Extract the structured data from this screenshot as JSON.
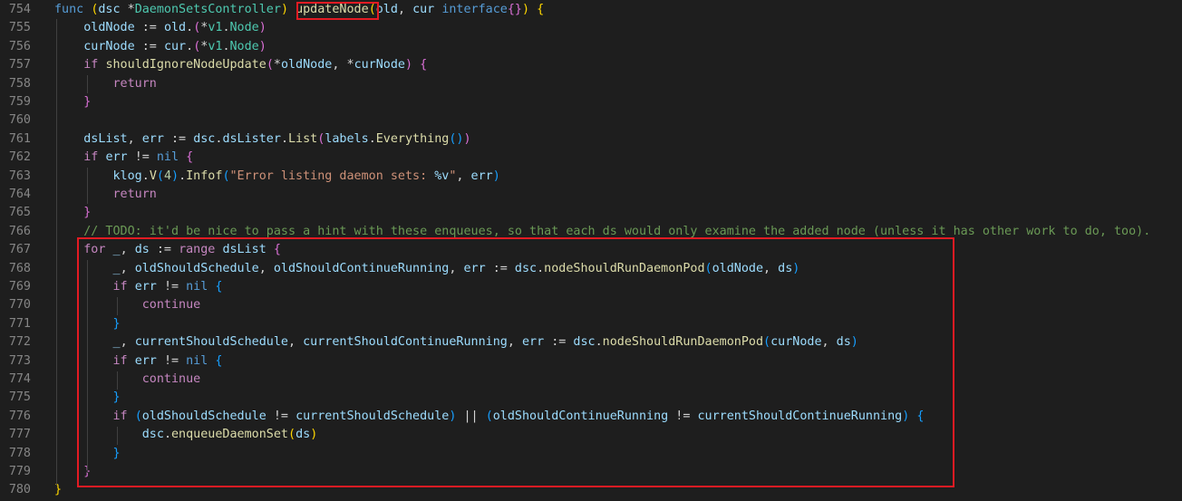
{
  "editor": {
    "theme_colors": {
      "background": "#1e1e1e",
      "line_number": "#858585",
      "keyword": "#569cd6",
      "control": "#c586c0",
      "function": "#dcdcaa",
      "variable": "#9cdcfe",
      "type": "#4ec9b0",
      "string": "#ce9178",
      "number": "#b5cea8",
      "comment": "#6a9955",
      "highlight_box": "#e31b23"
    },
    "lines": [
      {
        "n": "754",
        "t": [
          [
            "kw",
            "func "
          ],
          [
            "b1",
            "("
          ],
          [
            "var",
            "dsc "
          ],
          [
            "op",
            "*"
          ],
          [
            "typ",
            "DaemonSetsController"
          ],
          [
            "b1",
            ")"
          ],
          [
            "op",
            " "
          ],
          [
            "fn",
            "updateNode"
          ],
          [
            "b1",
            "("
          ],
          [
            "var",
            "old"
          ],
          [
            "op",
            ", "
          ],
          [
            "var",
            "cur "
          ],
          [
            "kw",
            "interface"
          ],
          [
            "b2",
            "{}"
          ],
          [
            "b1",
            ")"
          ],
          [
            "op",
            " "
          ],
          [
            "b1",
            "{"
          ]
        ]
      },
      {
        "n": "755",
        "t": [
          [
            "op",
            "    "
          ],
          [
            "var",
            "oldNode "
          ],
          [
            "op",
            ":= "
          ],
          [
            "var",
            "old"
          ],
          [
            "op",
            "."
          ],
          [
            "b2",
            "("
          ],
          [
            "op",
            "*"
          ],
          [
            "typ",
            "v1"
          ],
          [
            "op",
            "."
          ],
          [
            "typ",
            "Node"
          ],
          [
            "b2",
            ")"
          ]
        ]
      },
      {
        "n": "756",
        "t": [
          [
            "op",
            "    "
          ],
          [
            "var",
            "curNode "
          ],
          [
            "op",
            ":= "
          ],
          [
            "var",
            "cur"
          ],
          [
            "op",
            "."
          ],
          [
            "b2",
            "("
          ],
          [
            "op",
            "*"
          ],
          [
            "typ",
            "v1"
          ],
          [
            "op",
            "."
          ],
          [
            "typ",
            "Node"
          ],
          [
            "b2",
            ")"
          ]
        ]
      },
      {
        "n": "757",
        "t": [
          [
            "op",
            "    "
          ],
          [
            "ctl",
            "if "
          ],
          [
            "fn",
            "shouldIgnoreNodeUpdate"
          ],
          [
            "b2",
            "("
          ],
          [
            "op",
            "*"
          ],
          [
            "var",
            "oldNode"
          ],
          [
            "op",
            ", *"
          ],
          [
            "var",
            "curNode"
          ],
          [
            "b2",
            ")"
          ],
          [
            "op",
            " "
          ],
          [
            "b2",
            "{"
          ]
        ]
      },
      {
        "n": "758",
        "t": [
          [
            "op",
            "        "
          ],
          [
            "ctl",
            "return"
          ]
        ]
      },
      {
        "n": "759",
        "t": [
          [
            "op",
            "    "
          ],
          [
            "b2",
            "}"
          ]
        ]
      },
      {
        "n": "760",
        "t": []
      },
      {
        "n": "761",
        "t": [
          [
            "op",
            "    "
          ],
          [
            "var",
            "dsList"
          ],
          [
            "op",
            ", "
          ],
          [
            "var",
            "err "
          ],
          [
            "op",
            ":= "
          ],
          [
            "var",
            "dsc"
          ],
          [
            "op",
            "."
          ],
          [
            "var",
            "dsLister"
          ],
          [
            "op",
            "."
          ],
          [
            "fn",
            "List"
          ],
          [
            "b2",
            "("
          ],
          [
            "var",
            "labels"
          ],
          [
            "op",
            "."
          ],
          [
            "fn",
            "Everything"
          ],
          [
            "b3",
            "()"
          ],
          [
            "b2",
            ")"
          ]
        ]
      },
      {
        "n": "762",
        "t": [
          [
            "op",
            "    "
          ],
          [
            "ctl",
            "if "
          ],
          [
            "var",
            "err "
          ],
          [
            "op",
            "!= "
          ],
          [
            "kw",
            "nil "
          ],
          [
            "b2",
            "{"
          ]
        ]
      },
      {
        "n": "763",
        "t": [
          [
            "op",
            "        "
          ],
          [
            "var",
            "klog"
          ],
          [
            "op",
            "."
          ],
          [
            "fn",
            "V"
          ],
          [
            "b3",
            "("
          ],
          [
            "num",
            "4"
          ],
          [
            "b3",
            ")"
          ],
          [
            "op",
            "."
          ],
          [
            "fn",
            "Infof"
          ],
          [
            "b3",
            "("
          ],
          [
            "str",
            "\"Error listing daemon sets: "
          ],
          [
            "var",
            "%v"
          ],
          [
            "str",
            "\""
          ],
          [
            "op",
            ", "
          ],
          [
            "var",
            "err"
          ],
          [
            "b3",
            ")"
          ]
        ]
      },
      {
        "n": "764",
        "t": [
          [
            "op",
            "        "
          ],
          [
            "ctl",
            "return"
          ]
        ]
      },
      {
        "n": "765",
        "t": [
          [
            "op",
            "    "
          ],
          [
            "b2",
            "}"
          ]
        ]
      },
      {
        "n": "766",
        "t": [
          [
            "op",
            "    "
          ],
          [
            "cm",
            "// TODO: it'd be nice to pass a hint with these enqueues, so that each ds would only examine the added node (unless it has other work to do, too)."
          ]
        ]
      },
      {
        "n": "767",
        "t": [
          [
            "op",
            "    "
          ],
          [
            "ctl",
            "for "
          ],
          [
            "var",
            "_"
          ],
          [
            "op",
            ", "
          ],
          [
            "var",
            "ds "
          ],
          [
            "op",
            ":= "
          ],
          [
            "ctl",
            "range "
          ],
          [
            "var",
            "dsList "
          ],
          [
            "b2",
            "{"
          ]
        ]
      },
      {
        "n": "768",
        "t": [
          [
            "op",
            "        "
          ],
          [
            "var",
            "_"
          ],
          [
            "op",
            ", "
          ],
          [
            "var",
            "oldShouldSchedule"
          ],
          [
            "op",
            ", "
          ],
          [
            "var",
            "oldShouldContinueRunning"
          ],
          [
            "op",
            ", "
          ],
          [
            "var",
            "err "
          ],
          [
            "op",
            ":= "
          ],
          [
            "var",
            "dsc"
          ],
          [
            "op",
            "."
          ],
          [
            "fn",
            "nodeShouldRunDaemonPod"
          ],
          [
            "b3",
            "("
          ],
          [
            "var",
            "oldNode"
          ],
          [
            "op",
            ", "
          ],
          [
            "var",
            "ds"
          ],
          [
            "b3",
            ")"
          ]
        ]
      },
      {
        "n": "769",
        "t": [
          [
            "op",
            "        "
          ],
          [
            "ctl",
            "if "
          ],
          [
            "var",
            "err "
          ],
          [
            "op",
            "!= "
          ],
          [
            "kw",
            "nil "
          ],
          [
            "b3",
            "{"
          ]
        ]
      },
      {
        "n": "770",
        "t": [
          [
            "op",
            "            "
          ],
          [
            "ctl",
            "continue"
          ]
        ]
      },
      {
        "n": "771",
        "t": [
          [
            "op",
            "        "
          ],
          [
            "b3",
            "}"
          ]
        ]
      },
      {
        "n": "772",
        "t": [
          [
            "op",
            "        "
          ],
          [
            "var",
            "_"
          ],
          [
            "op",
            ", "
          ],
          [
            "var",
            "currentShouldSchedule"
          ],
          [
            "op",
            ", "
          ],
          [
            "var",
            "currentShouldContinueRunning"
          ],
          [
            "op",
            ", "
          ],
          [
            "var",
            "err "
          ],
          [
            "op",
            ":= "
          ],
          [
            "var",
            "dsc"
          ],
          [
            "op",
            "."
          ],
          [
            "fn",
            "nodeShouldRunDaemonPod"
          ],
          [
            "b3",
            "("
          ],
          [
            "var",
            "curNode"
          ],
          [
            "op",
            ", "
          ],
          [
            "var",
            "ds"
          ],
          [
            "b3",
            ")"
          ]
        ]
      },
      {
        "n": "773",
        "t": [
          [
            "op",
            "        "
          ],
          [
            "ctl",
            "if "
          ],
          [
            "var",
            "err "
          ],
          [
            "op",
            "!= "
          ],
          [
            "kw",
            "nil "
          ],
          [
            "b3",
            "{"
          ]
        ]
      },
      {
        "n": "774",
        "t": [
          [
            "op",
            "            "
          ],
          [
            "ctl",
            "continue"
          ]
        ]
      },
      {
        "n": "775",
        "t": [
          [
            "op",
            "        "
          ],
          [
            "b3",
            "}"
          ]
        ]
      },
      {
        "n": "776",
        "t": [
          [
            "op",
            "        "
          ],
          [
            "ctl",
            "if "
          ],
          [
            "b3",
            "("
          ],
          [
            "var",
            "oldShouldSchedule "
          ],
          [
            "op",
            "!= "
          ],
          [
            "var",
            "currentShouldSchedule"
          ],
          [
            "b3",
            ")"
          ],
          [
            "op",
            " || "
          ],
          [
            "b3",
            "("
          ],
          [
            "var",
            "oldShouldContinueRunning "
          ],
          [
            "op",
            "!= "
          ],
          [
            "var",
            "currentShouldContinueRunning"
          ],
          [
            "b3",
            ")"
          ],
          [
            "op",
            " "
          ],
          [
            "b3",
            "{"
          ]
        ]
      },
      {
        "n": "777",
        "t": [
          [
            "op",
            "            "
          ],
          [
            "var",
            "dsc"
          ],
          [
            "op",
            "."
          ],
          [
            "fn",
            "enqueueDaemonSet"
          ],
          [
            "b1",
            "("
          ],
          [
            "var",
            "ds"
          ],
          [
            "b1",
            ")"
          ]
        ]
      },
      {
        "n": "778",
        "t": [
          [
            "op",
            "        "
          ],
          [
            "b3",
            "}"
          ]
        ]
      },
      {
        "n": "779",
        "t": [
          [
            "op",
            "    "
          ],
          [
            "b2",
            "}"
          ]
        ]
      },
      {
        "n": "780",
        "t": [
          [
            "b1",
            "}"
          ]
        ]
      }
    ]
  }
}
